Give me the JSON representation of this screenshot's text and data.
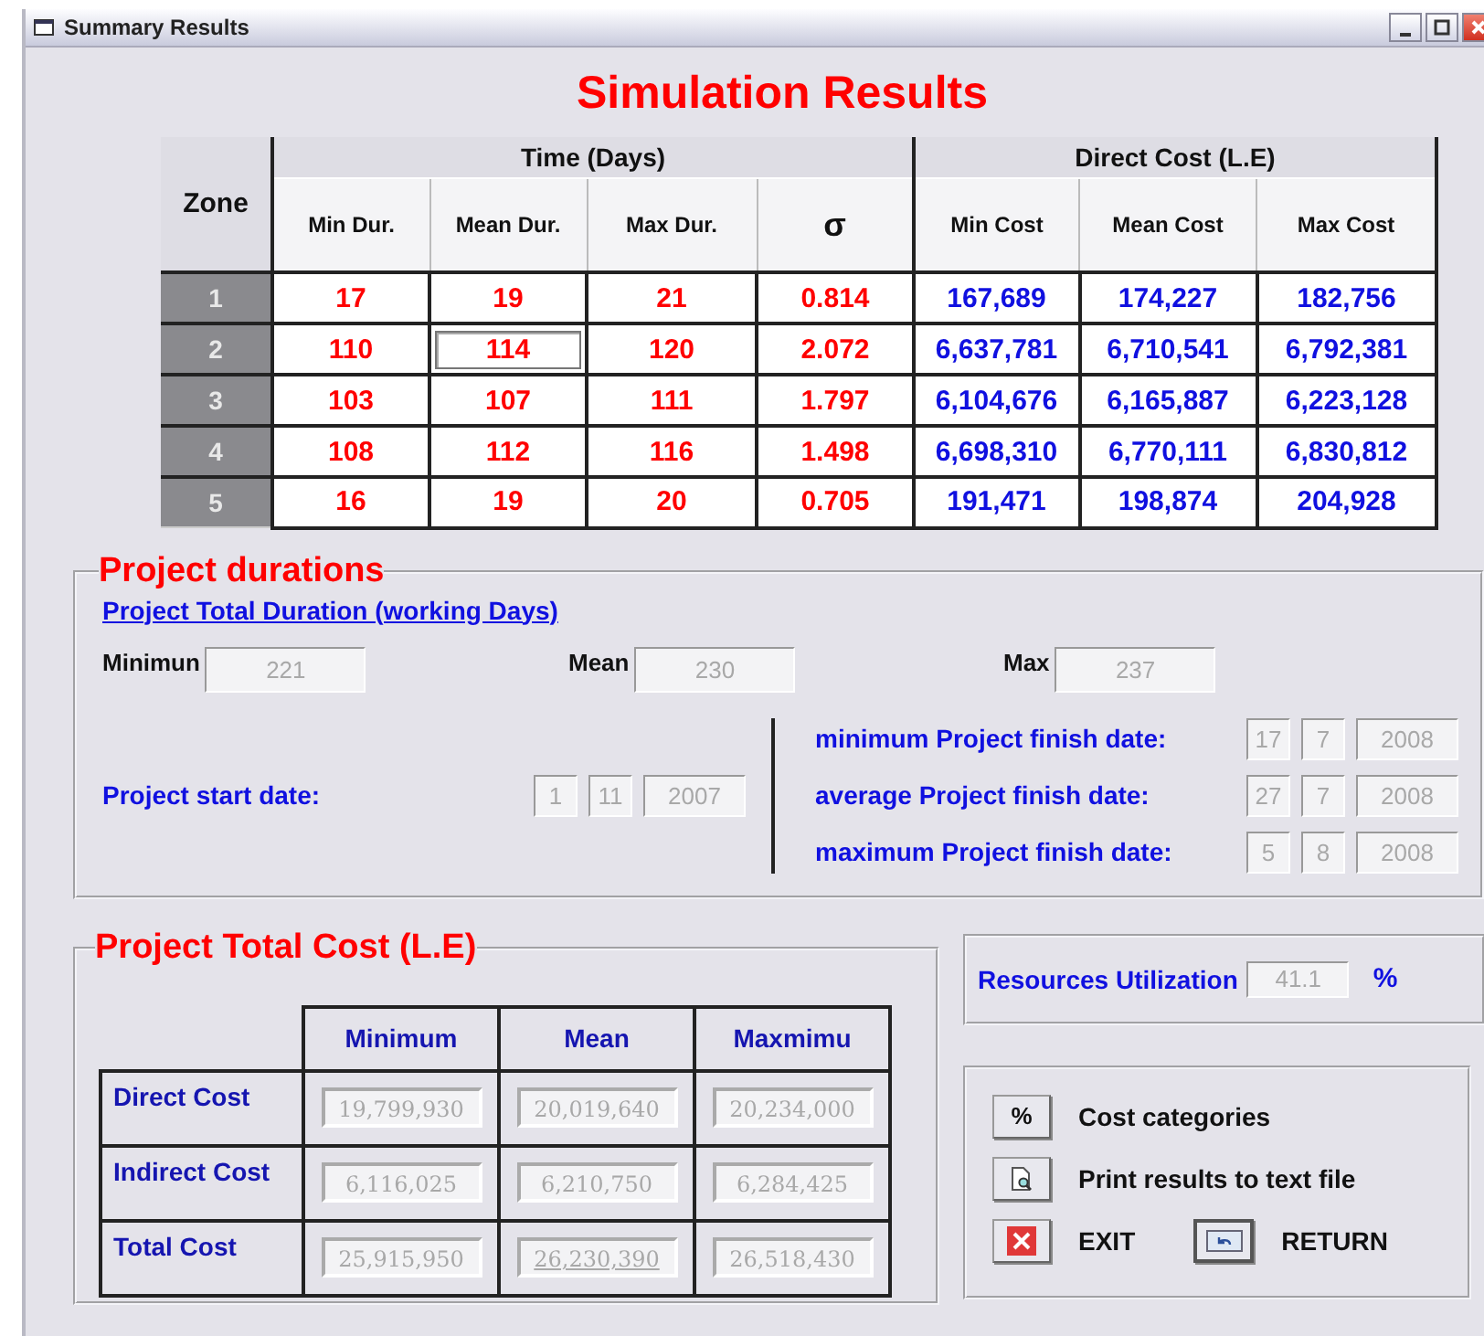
{
  "window": {
    "title": "Summary Results"
  },
  "heading": "Simulation Results",
  "results_table": {
    "zone_header": "Zone",
    "groups": [
      {
        "label": "Time (Days)",
        "kind": "time",
        "columns": [
          {
            "label": "Min Dur.",
            "kind": "text"
          },
          {
            "label": "Mean Dur.",
            "kind": "text"
          },
          {
            "label": "Max Dur.",
            "kind": "text"
          },
          {
            "label": "σ",
            "kind": "symbol"
          }
        ]
      },
      {
        "label": "Direct Cost (L.E)",
        "kind": "cost",
        "columns": [
          {
            "label": "Min Cost",
            "kind": "text"
          },
          {
            "label": "Mean Cost",
            "kind": "text"
          },
          {
            "label": "Max Cost",
            "kind": "text"
          }
        ]
      }
    ],
    "rows": [
      {
        "zone": "1",
        "cells": [
          {
            "text": "17",
            "focused": false
          },
          {
            "text": "19",
            "focused": false
          },
          {
            "text": "21",
            "focused": false
          },
          {
            "text": "0.814",
            "focused": false
          },
          {
            "text": "167,689",
            "focused": false
          },
          {
            "text": "174,227",
            "focused": false
          },
          {
            "text": "182,756",
            "focused": false
          }
        ]
      },
      {
        "zone": "2",
        "cells": [
          {
            "text": "110",
            "focused": false
          },
          {
            "text": "114",
            "focused": true
          },
          {
            "text": "120",
            "focused": false
          },
          {
            "text": "2.072",
            "focused": false
          },
          {
            "text": "6,637,781",
            "focused": false
          },
          {
            "text": "6,710,541",
            "focused": false
          },
          {
            "text": "6,792,381",
            "focused": false
          }
        ]
      },
      {
        "zone": "3",
        "cells": [
          {
            "text": "103",
            "focused": false
          },
          {
            "text": "107",
            "focused": false
          },
          {
            "text": "111",
            "focused": false
          },
          {
            "text": "1.797",
            "focused": false
          },
          {
            "text": "6,104,676",
            "focused": false
          },
          {
            "text": "6,165,887",
            "focused": false
          },
          {
            "text": "6,223,128",
            "focused": false
          }
        ]
      },
      {
        "zone": "4",
        "cells": [
          {
            "text": "108",
            "focused": false
          },
          {
            "text": "112",
            "focused": false
          },
          {
            "text": "116",
            "focused": false
          },
          {
            "text": "1.498",
            "focused": false
          },
          {
            "text": "6,698,310",
            "focused": false
          },
          {
            "text": "6,770,111",
            "focused": false
          },
          {
            "text": "6,830,812",
            "focused": false
          }
        ]
      },
      {
        "zone": "5",
        "cells": [
          {
            "text": "16",
            "focused": false
          },
          {
            "text": "19",
            "focused": false
          },
          {
            "text": "20",
            "focused": false
          },
          {
            "text": "0.705",
            "focused": false
          },
          {
            "text": "191,471",
            "focused": false
          },
          {
            "text": "198,874",
            "focused": false
          },
          {
            "text": "204,928",
            "focused": false
          }
        ]
      }
    ]
  },
  "durations": {
    "legend": "Project durations",
    "subheading": "Project Total Duration (working Days)",
    "totals": [
      {
        "label": "Minimun",
        "value": "221"
      },
      {
        "label": "Mean",
        "value": "230"
      },
      {
        "label": "Max",
        "value": "237"
      }
    ],
    "start_date": {
      "label": "Project start date:",
      "parts": [
        "1",
        "11",
        "2007"
      ]
    },
    "finish_dates": [
      {
        "label": "minimum Project finish date:",
        "parts": [
          "17",
          "7",
          "2008"
        ]
      },
      {
        "label": "average Project finish date:",
        "parts": [
          "27",
          "7",
          "2008"
        ]
      },
      {
        "label": "maximum Project finish date:",
        "parts": [
          "5",
          "8",
          "2008"
        ]
      }
    ]
  },
  "cost": {
    "legend": "Project Total Cost (L.E)",
    "columns": [
      "Minimum",
      "Mean",
      "Maxmimu"
    ],
    "rows": [
      {
        "label": "Direct Cost",
        "values": [
          {
            "text": "19,799,930",
            "focused": false
          },
          {
            "text": "20,019,640",
            "focused": false
          },
          {
            "text": "20,234,000",
            "focused": false
          }
        ]
      },
      {
        "label": "Indirect Cost",
        "values": [
          {
            "text": "6,116,025",
            "focused": false
          },
          {
            "text": "6,210,750",
            "focused": false
          },
          {
            "text": "6,284,425",
            "focused": false
          }
        ]
      },
      {
        "label": "Total Cost",
        "values": [
          {
            "text": "25,915,950",
            "focused": false
          },
          {
            "text": "26,230,390",
            "focused": true
          },
          {
            "text": "26,518,430",
            "focused": false
          }
        ]
      }
    ]
  },
  "resources": {
    "label": "Resources Utilization",
    "value": "41.1",
    "unit": "%"
  },
  "actions": [
    [
      {
        "kind": "percent",
        "button_text": "%",
        "label": "Cost categories"
      }
    ],
    [
      {
        "kind": "preview",
        "label": "Print results to text file"
      }
    ],
    [
      {
        "kind": "exit",
        "label": "EXIT"
      },
      {
        "kind": "return",
        "label": "RETURN"
      }
    ]
  ]
}
